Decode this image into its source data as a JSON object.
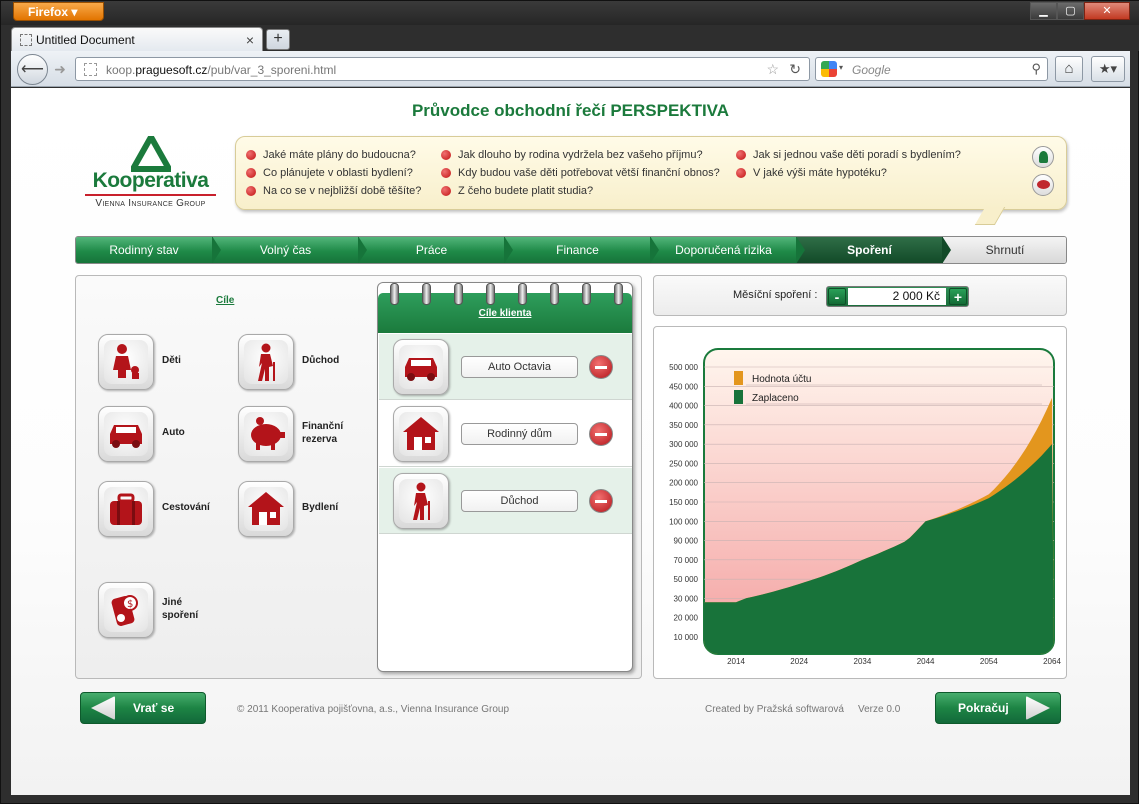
{
  "browser": {
    "app_button": "Firefox",
    "tab_title": "Untitled Document",
    "url_prefix": "koop.",
    "url_host": "praguesoft.cz",
    "url_path": "/pub/var_3_sporeni.html",
    "search_placeholder": "Google"
  },
  "page": {
    "title": "Průvodce obchodní řečí PERSPEKTIVA",
    "logo_name": "Kooperativa",
    "logo_sub": "Vienna Insurance Group"
  },
  "questions": [
    "Jaké máte plány do budoucna?",
    "Co plánujete v oblasti bydlení?",
    "Na co se v nejbližší době těšíte?",
    "Jak dlouho by rodina vydržela bez vašeho příjmu?",
    "Kdy budou vaše děti potřebovat větší finanční obnos?",
    "Z čeho budete platit studia?",
    "Jak si jednou vaše děti poradí s bydlením?",
    "V jaké výši máte hypotéku?"
  ],
  "steps": [
    "Rodinný stav",
    "Volný čas",
    "Práce",
    "Finance",
    "Doporučená rizika",
    "Spoření",
    "Shrnutí"
  ],
  "active_step": "Spoření",
  "goals": {
    "heading": "Cíle",
    "items": [
      {
        "label": "Děti",
        "icon": "child-icon"
      },
      {
        "label": "Důchod",
        "icon": "elderly-icon"
      },
      {
        "label": "Auto",
        "icon": "car-icon"
      },
      {
        "label": "Finanční\nrezerva",
        "icon": "piggy-bank-icon"
      },
      {
        "label": "Cestování",
        "icon": "suitcase-icon"
      },
      {
        "label": "Bydlení",
        "icon": "house-icon"
      },
      {
        "label": "Jiné\nspoření",
        "icon": "savings-tag-icon"
      }
    ]
  },
  "client_goals": {
    "heading": "Cíle klienta",
    "items": [
      {
        "value": "Auto Octavia",
        "icon": "car-icon"
      },
      {
        "value": "Rodinný dům",
        "icon": "house-icon"
      },
      {
        "value": "Důchod",
        "icon": "elderly-icon"
      }
    ]
  },
  "monthly": {
    "label": "Měsíční spoření :",
    "value": "2 000 Kč",
    "minus": "-",
    "plus": "+"
  },
  "chart_data": {
    "type": "area",
    "x": [
      2014,
      2024,
      2034,
      2044,
      2054,
      2064
    ],
    "y_ticks": [
      10000,
      20000,
      30000,
      50000,
      70000,
      90000,
      100000,
      150000,
      200000,
      250000,
      300000,
      350000,
      400000,
      450000,
      500000
    ],
    "y_tick_labels": [
      "10 000",
      "20 000",
      "30 000",
      "50 000",
      "70 000",
      "90 000",
      "100 000",
      "150 000",
      "200 000",
      "250 000",
      "300 000",
      "350 000",
      "400 000",
      "450 000",
      "500 000"
    ],
    "series": [
      {
        "name": "Hodnota účtu",
        "color": "#e3961e",
        "values": [
          28000,
          45000,
          70000,
          100000,
          170000,
          420000
        ]
      },
      {
        "name": "Zaplaceno",
        "color": "#18733a",
        "values": [
          28000,
          45000,
          70000,
          100000,
          160000,
          300000
        ]
      }
    ],
    "legend_position": "top-left",
    "grid": true
  },
  "buttons": {
    "back": "Vrať se",
    "next": "Pokračuj"
  },
  "footer": {
    "copyright": "© 2011 Kooperativa pojišťovna, a.s., Vienna Insurance Group",
    "credits": "Created by Pražská softwarová",
    "version": "Verze 0.0"
  },
  "colors": {
    "brand_green": "#1b7a3c",
    "brand_red": "#c8202c"
  }
}
